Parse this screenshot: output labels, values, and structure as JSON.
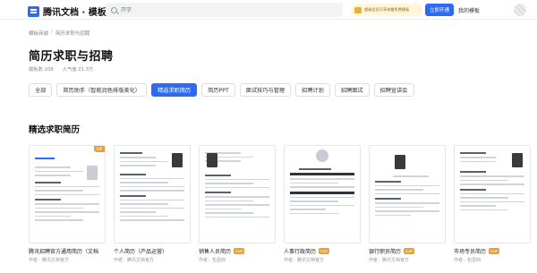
{
  "header": {
    "logo_text": "腾讯文档 · 模板",
    "search_placeholder": "开学",
    "promo_text": "超级会员可享海量免费模板",
    "cta_label": "立即开通",
    "my_templates": "我的模板"
  },
  "breadcrumb": [
    "模板商城",
    "简历求职与招聘"
  ],
  "page": {
    "title": "简历求职与招聘",
    "template_count": "模板数 208",
    "popularity": "人气值 21.3万"
  },
  "tabs": [
    {
      "label": "全部",
      "active": false
    },
    {
      "label": "简历助手（智能润色排版美化）",
      "active": false
    },
    {
      "label": "精选求职简历",
      "active": true
    },
    {
      "label": "简历PPT",
      "active": false
    },
    {
      "label": "面试技巧与管理",
      "active": false
    },
    {
      "label": "招聘计划",
      "active": false
    },
    {
      "label": "招聘面试",
      "active": false
    },
    {
      "label": "招聘宣讲会",
      "active": false
    }
  ],
  "section_title": "精选求职简历",
  "cards": [
    {
      "name": "腾讯招聘官方通用简历（文档）",
      "badge": "",
      "author": "作者：腾讯文档官方",
      "style": "blue"
    },
    {
      "name": "个人简历（产品运营）",
      "badge": "",
      "author": "作者：腾讯文档官方",
      "style": "plain"
    },
    {
      "name": "销售人员简历",
      "badge": "SVIP",
      "author": "作者：包壹四",
      "style": "photo"
    },
    {
      "name": "人事行政简历",
      "badge": "SVIP",
      "author": "作者：腾讯文档官方",
      "style": "darkband"
    },
    {
      "name": "银行职员简历",
      "badge": "SVIP",
      "author": "作者：腾讯文档官方",
      "style": "photo"
    },
    {
      "name": "市场专员简历",
      "badge": "SVIP",
      "author": "作者：包壹四",
      "style": "photo"
    }
  ]
}
